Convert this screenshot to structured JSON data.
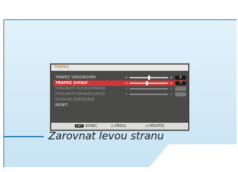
{
  "osd": {
    "title": "TRAPEZ",
    "items": [
      {
        "label": "TRAPEZ VODOROVNY",
        "value": "0",
        "level": 0.5,
        "state": "normal"
      },
      {
        "label": "TRAPEZ SVISLY",
        "value": "-7",
        "level": 0.45,
        "state": "selected"
      },
      {
        "label": "POSUNUTÍ VLEVO/VPRAVO",
        "value": "",
        "level": null,
        "state": "dim"
      },
      {
        "label": "POSUNUTÍ NAHORU/DOLŮ",
        "value": "",
        "level": null,
        "state": "dim"
      },
      {
        "label": "ROHOVÉ ZKRESLENÍ",
        "value": "",
        "level": null,
        "state": "dim"
      },
      {
        "label": "RESET.",
        "value": "",
        "level": null,
        "state": "normal"
      }
    ],
    "footer": {
      "exit_key": "EXIT",
      "exit_label": ":KONEC",
      "move_key": "⇕",
      "move_label": ":PŘESU.",
      "adjust_key": "↔",
      "adjust_label": ":PŘIZPŮS."
    }
  },
  "callout": {
    "text": "Zarovnat levou stranu"
  },
  "colors": {
    "accent": "#2a7fb5",
    "selected_row": "#d03636",
    "screen_bg": "#d6ebf7"
  }
}
